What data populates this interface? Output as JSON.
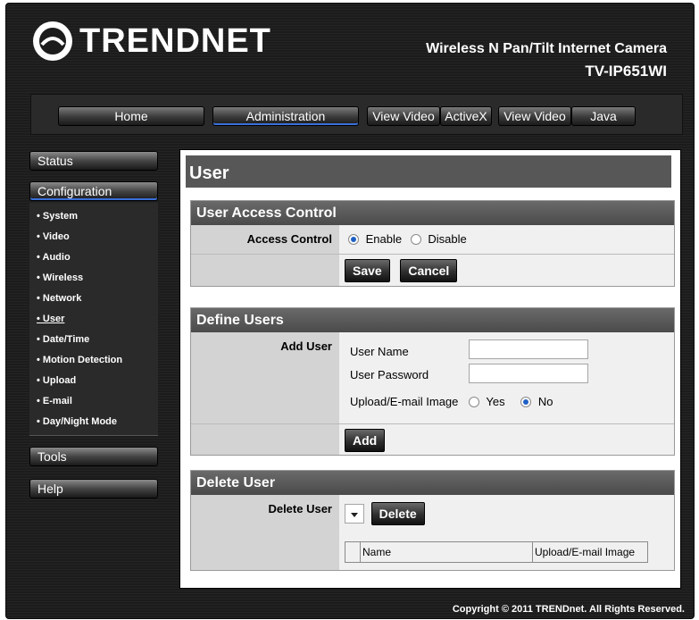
{
  "brand": {
    "logo_text": "TRENDNET",
    "product_line": "Wireless N Pan/Tilt Internet Camera",
    "model": "TV-IP651WI"
  },
  "nav": {
    "home": "Home",
    "administration": "Administration",
    "view_video_activex_1": "View Video",
    "view_video_activex_2": "ActiveX",
    "view_video_java_1": "View Video",
    "view_video_java_2": "Java"
  },
  "sidebar": {
    "status": "Status",
    "configuration": "Configuration",
    "items": [
      "• System",
      "• Video",
      "• Audio",
      "• Wireless",
      "• Network",
      "• User",
      "• Date/Time",
      "• Motion Detection",
      "• Upload",
      "• E-mail",
      "• Day/Night Mode"
    ],
    "active_index": 5,
    "tools": "Tools",
    "help": "Help"
  },
  "page": {
    "title": "User",
    "uac": {
      "heading": "User Access Control",
      "label": "Access Control",
      "enable": "Enable",
      "disable": "Disable",
      "selected": "Enable",
      "save": "Save",
      "cancel": "Cancel"
    },
    "define": {
      "heading": "Define Users",
      "label": "Add User",
      "username_label": "User Name",
      "username_value": "",
      "password_label": "User Password",
      "password_value": "",
      "upload_label": "Upload/E-mail Image",
      "yes": "Yes",
      "no": "No",
      "selected": "No",
      "add": "Add"
    },
    "delete": {
      "heading": "Delete User",
      "label": "Delete User",
      "select_value": "",
      "delete": "Delete",
      "columns": [
        "Name",
        "Upload/E-mail Image"
      ]
    }
  },
  "footer": "Copyright © 2011 TRENDnet. All Rights Reserved."
}
